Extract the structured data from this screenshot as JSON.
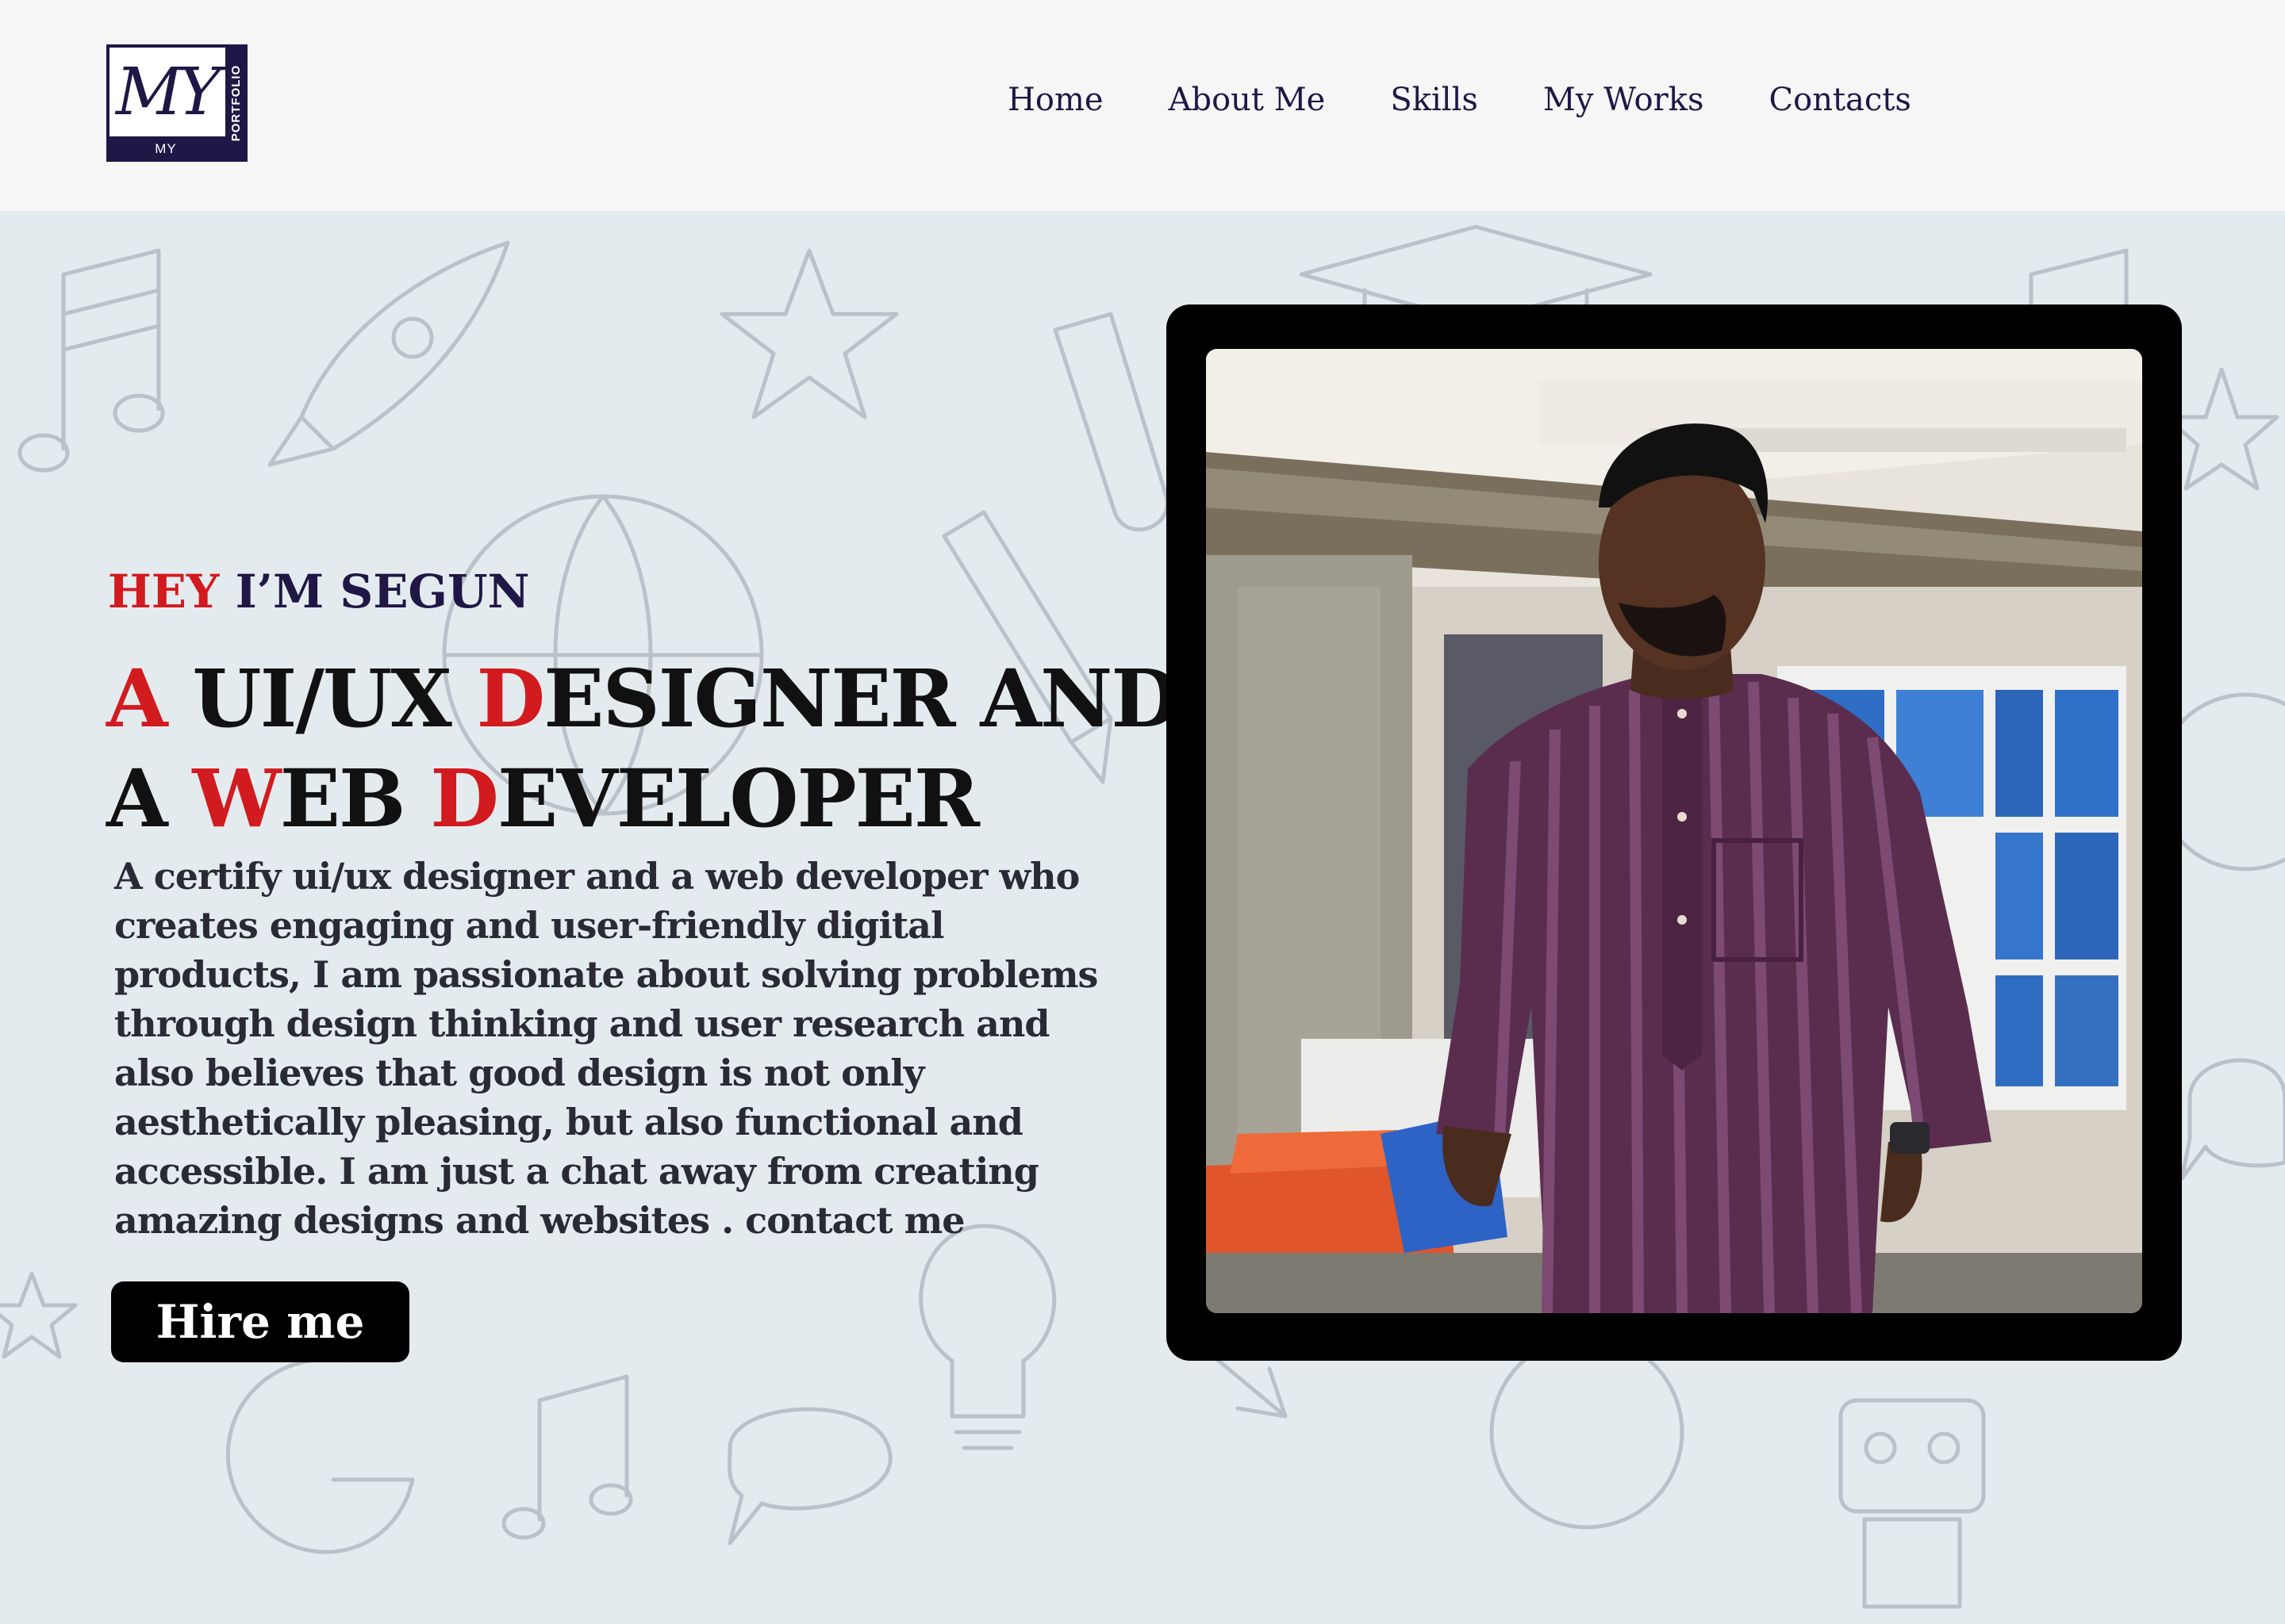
{
  "header": {
    "logo": {
      "script_text": "MY",
      "bottom_text": "MY",
      "side_text": "PORTFOLIO"
    },
    "nav": [
      {
        "label": "Home"
      },
      {
        "label": "About Me"
      },
      {
        "label": "Skills"
      },
      {
        "label": "My Works"
      },
      {
        "label": "Contacts"
      }
    ]
  },
  "hero": {
    "greeting_accent": "HEY",
    "greeting_rest": " I’M SEGUN",
    "headline": {
      "l1_a": "A",
      "l1_b": " UI/UX ",
      "l1_c": "D",
      "l1_d": "ESIGNER AND",
      "l2_a": "A ",
      "l2_b": "W",
      "l2_c": "EB ",
      "l2_d": "D",
      "l2_e": "EVELOPER"
    },
    "bio_lines": [
      "A certify ui/ux designer and a web developer who",
      "creates engaging and user-friendly digital",
      "products, I am passionate about solving problems",
      "through design thinking and user research and",
      "also believes that good design is not only",
      "aesthetically pleasing, but also functional and",
      "accessible. I am just a chat away from creating",
      "amazing designs and websites  . contact me"
    ],
    "cta_label": "Hire me"
  },
  "colors": {
    "accent_red": "#d21b1f",
    "navy": "#1f1746",
    "background": "#e4ebee",
    "header_bg": "#f6f6f7"
  }
}
